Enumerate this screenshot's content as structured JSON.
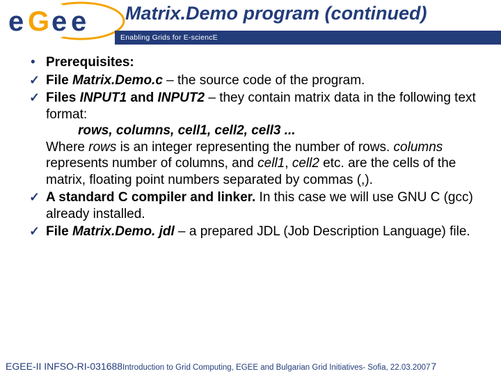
{
  "header": {
    "title_pre": "Matrix.",
    "title_post": "Demo program (continued)",
    "tagline": "Enabling Grids for E-sciencE",
    "logo_text": "eGee"
  },
  "body": {
    "prereq_label": "Prerequisites:",
    "item1_a": "File ",
    "item1_file": "Matrix.Demo.c",
    "item1_b": " – the source code of the program.",
    "item2_a": "Files ",
    "item2_f1": "INPUT1",
    "item2_and": " and ",
    "item2_f2": "INPUT2",
    "item2_b": " – they contain matrix data in the following text format:",
    "item2_fmt": "rows, columns, cell1, cell2, cell3 ...",
    "item2_c1": "Where ",
    "item2_rows": "rows",
    "item2_c2": " is an integer representing the number of rows. ",
    "item2_cols": "columns",
    "item2_c3": " represents number of columns, and ",
    "item2_cell1": "cell1",
    "item2_c4": ", ",
    "item2_cell2": "cell2",
    "item2_c5": " etc. are the cells of the matrix, floating point numbers separated by commas (,).",
    "item3_a": "A standard C compiler and linker.",
    "item3_b": " In this case we will use GNU C (gcc) already installed.",
    "item4_a": "File ",
    "item4_file": "Matrix.Demo. jdl",
    "item4_b": " – a prepared JDL (Job Description Language) file."
  },
  "footer": {
    "left": "EGEE-II INFSO-RI-031688",
    "center": " Introduction to Grid Computing, EGEE and Bulgarian Grid Initiatives- Sofia, 22.03.2007",
    "page": "7"
  }
}
